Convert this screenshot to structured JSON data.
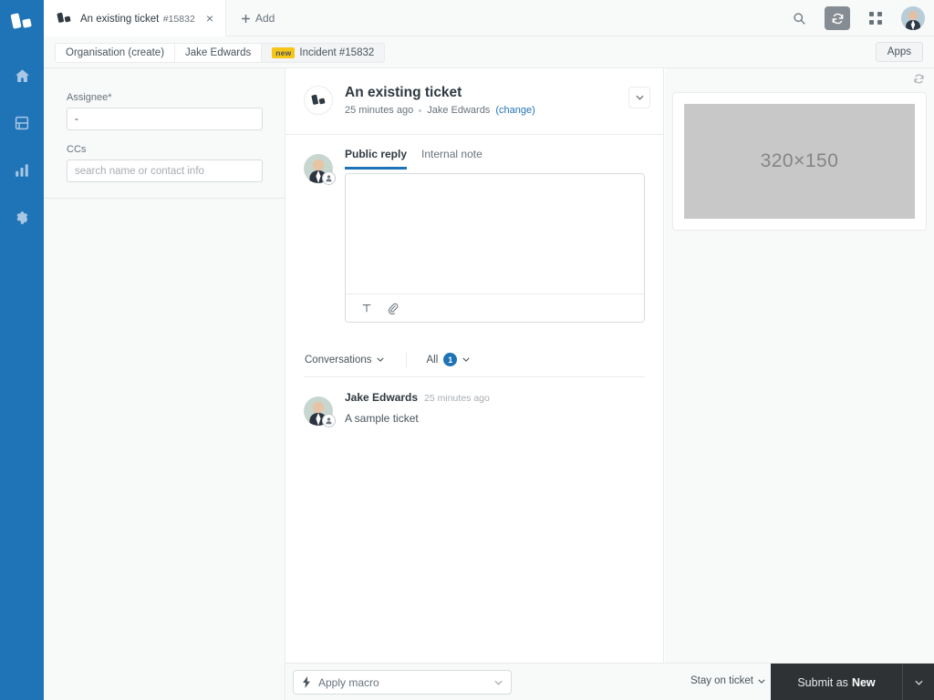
{
  "brand": {
    "primary": "#1f73b7",
    "badge_yellow": "#f5c518",
    "dark_button": "#2f3235"
  },
  "rail": {
    "logo_name": "zendesk-logo",
    "items": [
      {
        "name": "home-icon",
        "label": "Home"
      },
      {
        "name": "views-icon",
        "label": "Views"
      },
      {
        "name": "reporting-icon",
        "label": "Reporting"
      },
      {
        "name": "settings-gear-icon",
        "label": "Settings"
      }
    ]
  },
  "topbar": {
    "tab": {
      "title": "An existing ticket",
      "subtitle": "#15832",
      "close_label": "×"
    },
    "add_label": "Add",
    "actions": [
      {
        "name": "search-icon",
        "label": "Search"
      },
      {
        "name": "refresh-icon",
        "label": "Refresh"
      },
      {
        "name": "apps-grid-icon",
        "label": "Products"
      }
    ],
    "avatar_name": "user-avatar"
  },
  "breadcrumb": {
    "items": [
      {
        "label": "Organisation (create)",
        "badge": ""
      },
      {
        "label": "Jake Edwards",
        "badge": ""
      },
      {
        "label": "Incident #15832",
        "badge": "new"
      }
    ],
    "apps_button": "Apps"
  },
  "properties": {
    "assignee": {
      "label": "Assignee*",
      "value": "-",
      "placeholder": ""
    },
    "ccs": {
      "label": "CCs",
      "value": "",
      "placeholder": "search name or contact info"
    }
  },
  "ticket": {
    "title": "An existing ticket",
    "time": "25 minutes ago",
    "requester": "Jake Edwards",
    "change_link": "(change)"
  },
  "composer": {
    "tabs": [
      {
        "label": "Public reply",
        "active": true
      },
      {
        "label": "Internal note",
        "active": false
      }
    ],
    "body": "",
    "placeholder": "",
    "toolbar": [
      {
        "name": "text-format-icon",
        "glyph": "T"
      },
      {
        "name": "attachment-paperclip-icon",
        "glyph": ""
      }
    ]
  },
  "conversation_bar": {
    "left_label": "Conversations",
    "filter_label": "All",
    "count": "1"
  },
  "comments": [
    {
      "author": "Jake Edwards",
      "time": "25 minutes ago",
      "text": "A sample ticket"
    }
  ],
  "apps_panel": {
    "refresh_name": "apps-refresh-icon",
    "placeholder_label": "320×150"
  },
  "footer": {
    "macro_label": "Apply macro",
    "stay_label": "Stay on ticket",
    "submit_prefix": "Submit as",
    "submit_status": "New"
  }
}
